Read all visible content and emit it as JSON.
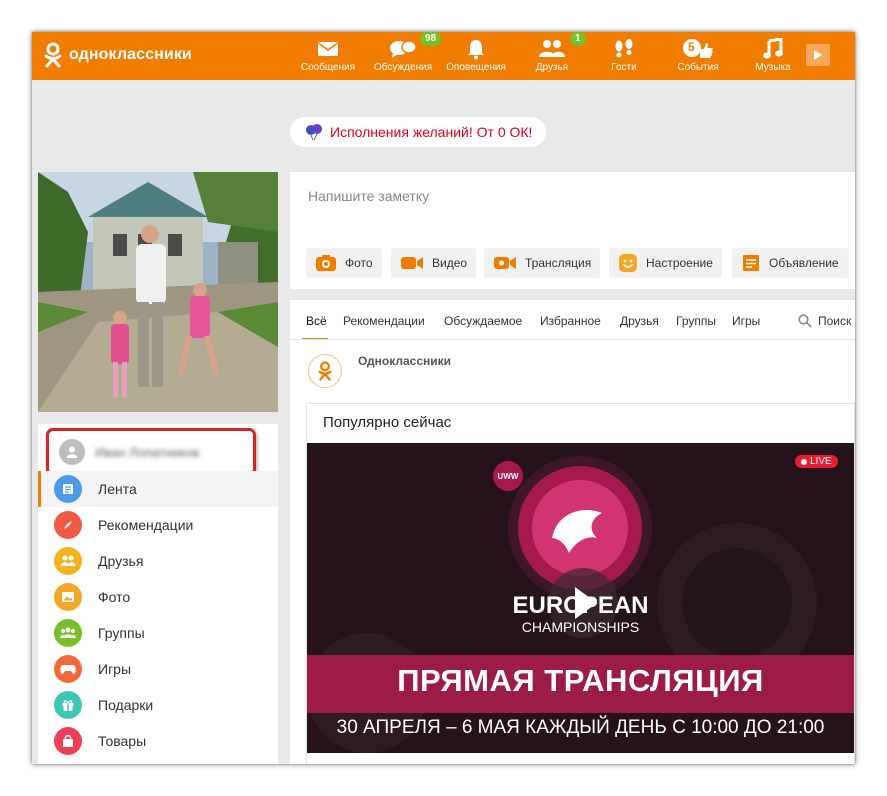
{
  "brand": {
    "name": "одноклассники",
    "color": "#f07d00"
  },
  "nav": [
    {
      "label": "Сообщения",
      "icon": "envelope-icon"
    },
    {
      "label": "Обсуждения",
      "icon": "chat-bubbles-icon",
      "badge": "98"
    },
    {
      "label": "Оповещения",
      "icon": "bell-icon"
    },
    {
      "label": "Друзья",
      "icon": "friends-icon",
      "badge": "1"
    },
    {
      "label": "Гости",
      "icon": "footprints-icon"
    },
    {
      "label": "События",
      "icon": "events-icon",
      "badge": "5"
    },
    {
      "label": "Музыка",
      "icon": "music-note-icon"
    }
  ],
  "banner": {
    "text": "Исполнения желаний! От 0 ОК!"
  },
  "profile": {
    "name": "Иван Лопатников"
  },
  "sidebar": {
    "items": [
      {
        "label": "Лента",
        "icon": "feed-icon",
        "color": "#4c9be8"
      },
      {
        "label": "Рекомендации",
        "icon": "compass-icon",
        "color": "#ef5a44"
      },
      {
        "label": "Друзья",
        "icon": "friends-icon",
        "color": "#f5b21c"
      },
      {
        "label": "Фото",
        "icon": "photo-icon",
        "color": "#f5a623"
      },
      {
        "label": "Группы",
        "icon": "groups-icon",
        "color": "#78c028"
      },
      {
        "label": "Игры",
        "icon": "gamepad-icon",
        "color": "#f06a3b"
      },
      {
        "label": "Подарки",
        "icon": "gift-icon",
        "color": "#3dc6b4"
      },
      {
        "label": "Товары",
        "icon": "shopping-bag-icon",
        "color": "#ee3f56"
      }
    ]
  },
  "composer": {
    "placeholder": "Напишите заметку",
    "buttons": [
      {
        "label": "Фото",
        "icon": "camera-icon"
      },
      {
        "label": "Видео",
        "icon": "video-camera-icon"
      },
      {
        "label": "Трансляция",
        "icon": "broadcast-icon"
      },
      {
        "label": "Настроение",
        "icon": "smile-icon"
      },
      {
        "label": "Объявление",
        "icon": "ad-icon"
      }
    ]
  },
  "feed": {
    "tabs": [
      "Всё",
      "Рекомендации",
      "Обсуждаемое",
      "Избранное",
      "Друзья",
      "Группы",
      "Игры"
    ],
    "search_label": "Поиск",
    "source": "Одноклассники",
    "card_title": "Популярно сейчас",
    "video": {
      "live_label": "LIVE",
      "org_label": "UWW",
      "title_line1": "EUROPEAN",
      "title_line2": "CHAMPIONSHIPS",
      "headline": "ПРЯМАЯ ТРАНСЛЯЦИЯ",
      "dates": "30 АПРЕЛЯ – 6 МАЯ КАЖДЫЙ ДЕНЬ С 10:00 ДО 21:00"
    }
  }
}
